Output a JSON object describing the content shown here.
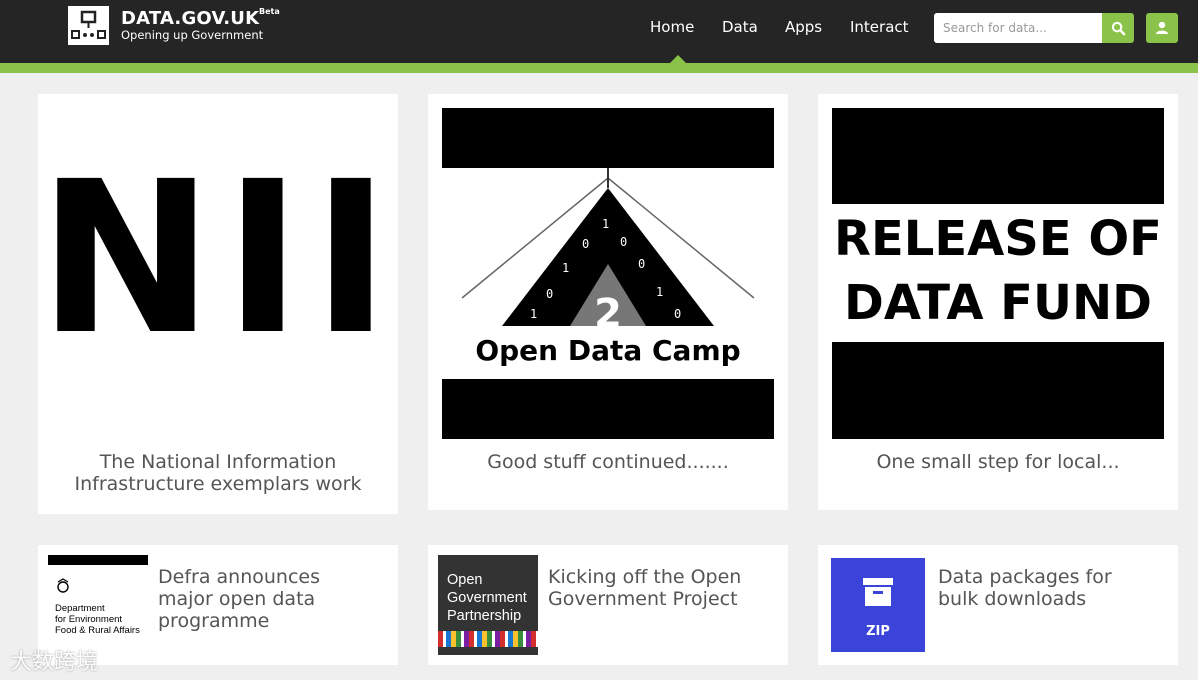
{
  "header": {
    "brand": "DATA.GOV.UK",
    "beta": "Beta",
    "tagline": "Opening up Government",
    "nav": [
      "Home",
      "Data",
      "Apps",
      "Interact"
    ],
    "search_placeholder": "Search for data...",
    "accent_color": "#8bc34a"
  },
  "featured": [
    {
      "image_text": "NII",
      "title_line1": "The National Information",
      "title_line2": "Infrastructure exemplars work"
    },
    {
      "image_text": "Open Data Camp",
      "image_number": "2",
      "title": "Good stuff continued......."
    },
    {
      "image_line1": "RELEASE OF",
      "image_line2": "DATA FUND",
      "title": "One small step for local..."
    }
  ],
  "news": [
    {
      "thumb_line1": "Department",
      "thumb_line2": "for Environment",
      "thumb_line3": "Food & Rural Affairs",
      "title": "Defra announces major open data programme"
    },
    {
      "thumb_line1": "Open",
      "thumb_line2": "Government",
      "thumb_line3": "Partnership",
      "title": "Kicking off the Open Government Project"
    },
    {
      "thumb_label": "ZIP",
      "title": "Data packages for bulk downloads"
    }
  ],
  "watermark": "大数跨境"
}
